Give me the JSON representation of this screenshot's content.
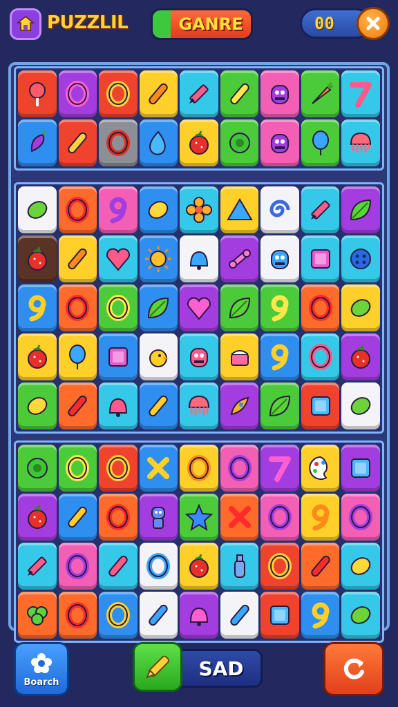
{
  "header": {
    "logo_text": "PUZZLIL",
    "mode_label": "GANRE",
    "score": "00",
    "colors": {
      "logo": "#ffd23a",
      "mode_bg": "#e23c1c",
      "score_bg": "#2a4aa0",
      "close_bg": "#f07a10"
    }
  },
  "board": {
    "sections": [
      {
        "rows": [
          [
            [
              "red",
              "lollipop"
            ],
            [
              "purple",
              "ring"
            ],
            [
              "red",
              "ring"
            ],
            [
              "yellow",
              "stick"
            ],
            [
              "teal",
              "crayon"
            ],
            [
              "green",
              "stick"
            ],
            [
              "pink",
              "monster"
            ],
            [
              "green",
              "carrot"
            ],
            [
              "teal",
              "seven"
            ]
          ],
          [
            [
              "blue",
              "pepper"
            ],
            [
              "red",
              "stick"
            ],
            [
              "gray",
              "ring"
            ],
            [
              "blue",
              "drop"
            ],
            [
              "yellow",
              "apple"
            ],
            [
              "green",
              "blob"
            ],
            [
              "pink",
              "monster"
            ],
            [
              "green",
              "balloon"
            ],
            [
              "teal",
              "jelly"
            ]
          ]
        ]
      },
      {
        "rows": [
          [
            [
              "white",
              "lime"
            ],
            [
              "orange",
              "ring"
            ],
            [
              "pink",
              "nine"
            ],
            [
              "blue",
              "lemon"
            ],
            [
              "teal",
              "flower"
            ],
            [
              "yellow",
              "triangle"
            ],
            [
              "white",
              "swirl"
            ],
            [
              "teal",
              "crayon"
            ],
            [
              "purple",
              "leaf"
            ]
          ],
          [
            [
              "brown",
              "strawberry"
            ],
            [
              "yellow",
              "stick"
            ],
            [
              "teal",
              "heart"
            ],
            [
              "blue",
              "sun"
            ],
            [
              "white",
              "bell"
            ],
            [
              "purple",
              "bone"
            ],
            [
              "white",
              "monster"
            ],
            [
              "teal",
              "square"
            ],
            [
              "teal",
              "button"
            ]
          ],
          [
            [
              "blue",
              "nine"
            ],
            [
              "orange",
              "ring"
            ],
            [
              "green",
              "ring"
            ],
            [
              "blue",
              "leaf-q"
            ],
            [
              "purple",
              "heart"
            ],
            [
              "green",
              "leaf"
            ],
            [
              "green",
              "nine"
            ],
            [
              "orange",
              "ring"
            ],
            [
              "yellow",
              "lime"
            ]
          ],
          [
            [
              "yellow",
              "apple"
            ],
            [
              "yellow",
              "balloon"
            ],
            [
              "blue",
              "square"
            ],
            [
              "white",
              "chick"
            ],
            [
              "teal",
              "monster"
            ],
            [
              "yellow",
              "cake"
            ],
            [
              "blue",
              "nine"
            ],
            [
              "teal",
              "ring"
            ],
            [
              "purple",
              "strawberry"
            ]
          ],
          [
            [
              "green",
              "lemon"
            ],
            [
              "orange",
              "stick"
            ],
            [
              "teal",
              "bell"
            ],
            [
              "blue",
              "stick"
            ],
            [
              "teal",
              "jelly"
            ],
            [
              "purple",
              "rocket"
            ],
            [
              "green",
              "leaf"
            ],
            [
              "red",
              "screen"
            ],
            [
              "white",
              "lime"
            ]
          ]
        ]
      },
      {
        "rows": [
          [
            [
              "green",
              "blob"
            ],
            [
              "green",
              "ring"
            ],
            [
              "red",
              "ring"
            ],
            [
              "blue",
              "x"
            ],
            [
              "yellow",
              "ring"
            ],
            [
              "pink",
              "ring"
            ],
            [
              "purple",
              "seven"
            ],
            [
              "yellow",
              "palette"
            ],
            [
              "purple",
              "screen"
            ]
          ],
          [
            [
              "purple",
              "apple"
            ],
            [
              "blue",
              "stick"
            ],
            [
              "orange",
              "ring"
            ],
            [
              "purple",
              "robot"
            ],
            [
              "green",
              "star"
            ],
            [
              "orange",
              "x"
            ],
            [
              "pink",
              "ring"
            ],
            [
              "yellow",
              "nine"
            ],
            [
              "pink",
              "ring"
            ]
          ],
          [
            [
              "teal",
              "crayon"
            ],
            [
              "pink",
              "ring"
            ],
            [
              "teal",
              "stick"
            ],
            [
              "white",
              "ring"
            ],
            [
              "yellow",
              "strawberry"
            ],
            [
              "teal",
              "bottle"
            ],
            [
              "red",
              "ring"
            ],
            [
              "orange",
              "stick"
            ],
            [
              "teal",
              "lemon"
            ]
          ],
          [
            [
              "orange",
              "leaf-cluster"
            ],
            [
              "orange",
              "ring"
            ],
            [
              "blue",
              "ring"
            ],
            [
              "white",
              "stick"
            ],
            [
              "purple",
              "bell"
            ],
            [
              "white",
              "stick"
            ],
            [
              "red",
              "screen"
            ],
            [
              "blue",
              "nine"
            ],
            [
              "teal",
              "lime"
            ]
          ]
        ]
      }
    ]
  },
  "footer": {
    "search_label": "Boarch",
    "action_label": "SAD",
    "colors": {
      "search_bg": "#1f6ad8",
      "pencil_bg": "#2aa81e",
      "refresh_bg": "#e0401a"
    }
  }
}
